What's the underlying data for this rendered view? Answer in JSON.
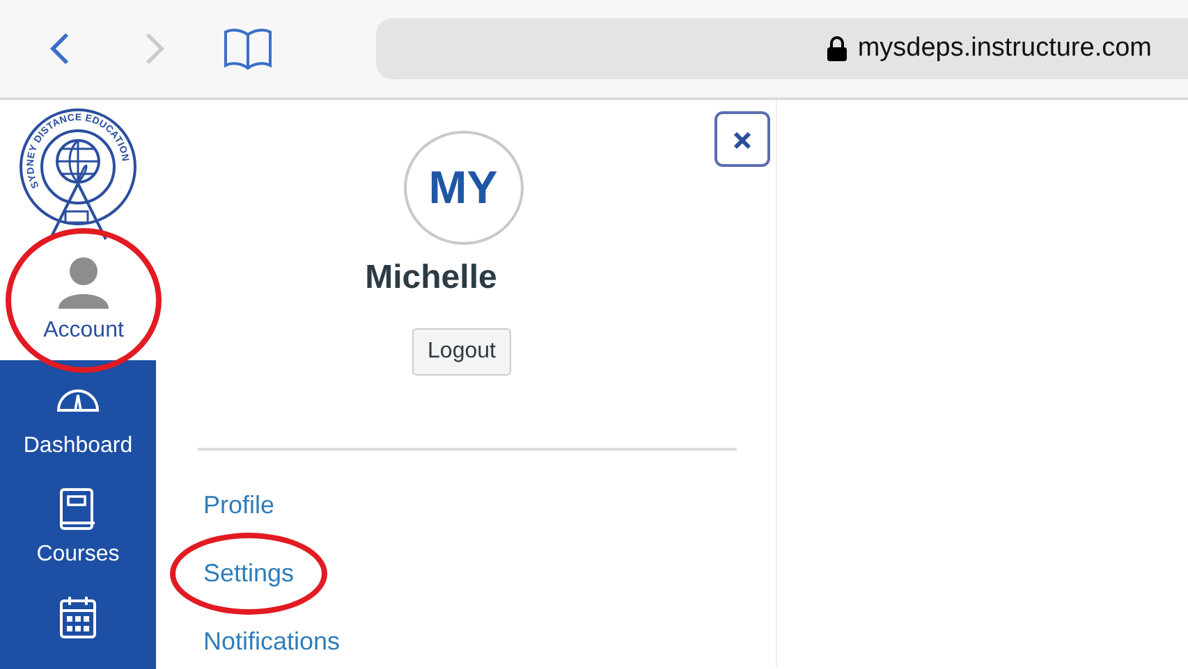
{
  "browser": {
    "address": "mysdeps.instructure.com",
    "back_enabled": true,
    "forward_enabled": false
  },
  "logo": {
    "arc_text": "SYDNEY DISTANCE EDUCATION"
  },
  "global_nav": [
    {
      "kind": "account",
      "label": "Account",
      "highlighted": true
    },
    {
      "kind": "dashboard",
      "label": "Dashboard",
      "highlighted": false
    },
    {
      "kind": "courses",
      "label": "Courses",
      "highlighted": false
    },
    {
      "kind": "calendar",
      "highlighted": false
    }
  ],
  "account_tray": {
    "avatar_initials": "MY",
    "user_name": "Michelle",
    "logout_button": "Logout",
    "links": [
      {
        "label": "Profile",
        "highlighted": false
      },
      {
        "label": "Settings",
        "highlighted": true
      },
      {
        "label": "Notifications",
        "highlighted": false
      }
    ]
  }
}
